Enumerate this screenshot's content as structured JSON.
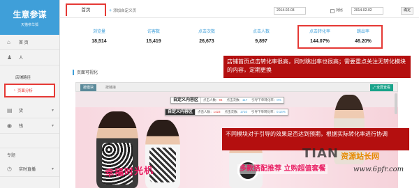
{
  "sidebar": {
    "title": "生意参谋",
    "subtitle": "天猫参华狐",
    "items": [
      {
        "label": "首 页",
        "icon": "home-icon"
      },
      {
        "label": "人",
        "icon": "person-icon"
      }
    ],
    "sub_items": [
      {
        "label": "店铺路径"
      },
      {
        "label": "页面分析",
        "active": true
      }
    ],
    "items2": [
      {
        "label": "货",
        "icon": "cart-icon"
      },
      {
        "label": "钱",
        "icon": "money-icon"
      }
    ],
    "group_label": "专题",
    "live_label": "实时直播"
  },
  "topbar": {
    "home_tab": "首页",
    "add_home": "添加自定义页",
    "date_start": "2014-02-03",
    "compare_label": "对比",
    "date_compare": "2014-02-02",
    "confirm": "确定"
  },
  "metrics": [
    {
      "label": "浏览量",
      "value": "18,514"
    },
    {
      "label": "访客数",
      "value": "15,419"
    },
    {
      "label": "点击次数",
      "value": "26,673"
    },
    {
      "label": "点击人数",
      "value": "9,897"
    },
    {
      "label": "点击转化率",
      "value": "144.07%"
    },
    {
      "label": "跳出率",
      "value": "46.20%"
    }
  ],
  "callouts": {
    "top": "店铺首页点击转化率很高，同时跳出率也很高；需要重点关注无转化模块的内容，定期更换",
    "bottom": "不同模块对于引导的效果是否达到预期，根据实际转化率进行协调"
  },
  "section": {
    "title": "页面可视化",
    "tab_on": "按模块",
    "tab_off": "按链接",
    "fullview": "全屏查看"
  },
  "tooltips": [
    {
      "name": "自定义内容区",
      "clickers_label": "点击人数：",
      "clickers": "94",
      "clicks_label": "点击次数：",
      "clicks": "117",
      "rate_label": "引导下单转化率：",
      "rate": "0%"
    },
    {
      "name": "自定义内容区",
      "clickers_label": "点击人数：",
      "clickers": "1423",
      "clicks_label": "点击次数：",
      "clicks": "1710",
      "rate_label": "引导下单转化率：",
      "rate": "0.14%"
    }
  ],
  "promos": {
    "left": "幸福时光机",
    "center": "多款搭配推荐 立购超值套餐"
  },
  "watermark": {
    "brand": "TIAN",
    "cn": "资源站长网",
    "url": "www.6pfr.com"
  }
}
